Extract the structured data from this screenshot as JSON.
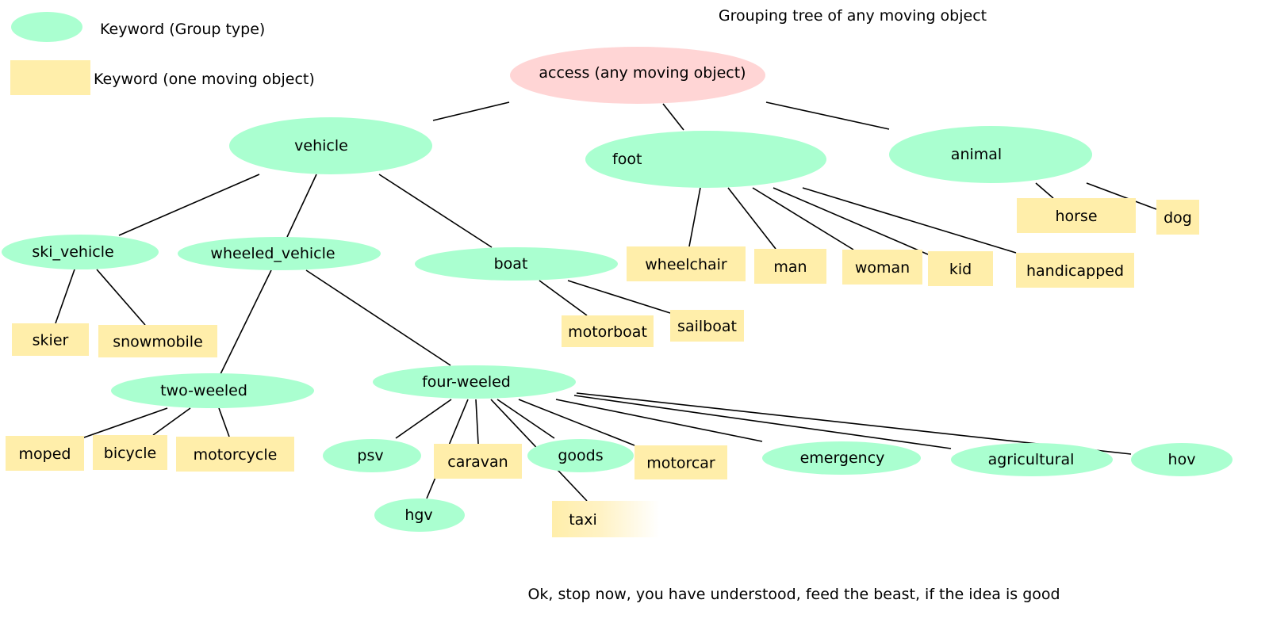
{
  "title": "Grouping tree of any moving object",
  "footer": "Ok, stop now, you have understood, feed the beast, if the idea is good",
  "legend": {
    "group": "Keyword (Group type)",
    "object": "Keyword (one moving object)"
  },
  "colors": {
    "root": "#ffd5d5",
    "group": "#aaffd0",
    "object": "#ffeeaa",
    "edge": "#000000"
  },
  "nodes": [
    {
      "id": "access",
      "label": "access (any moving object)",
      "type": "root"
    },
    {
      "id": "vehicle",
      "label": "vehicle",
      "type": "group"
    },
    {
      "id": "foot",
      "label": "foot",
      "type": "group"
    },
    {
      "id": "animal",
      "label": "animal",
      "type": "group"
    },
    {
      "id": "ski_vehicle",
      "label": "ski_vehicle",
      "type": "group"
    },
    {
      "id": "wheeled_vehicle",
      "label": "wheeled_vehicle",
      "type": "group"
    },
    {
      "id": "boat",
      "label": "boat",
      "type": "group"
    },
    {
      "id": "two_weeled",
      "label": "two-weeled",
      "type": "group"
    },
    {
      "id": "four_weeled",
      "label": "four-weeled",
      "type": "group"
    },
    {
      "id": "psv",
      "label": "psv",
      "type": "group"
    },
    {
      "id": "goods",
      "label": "goods",
      "type": "group"
    },
    {
      "id": "emergency",
      "label": "emergency",
      "type": "group"
    },
    {
      "id": "agricultural",
      "label": "agricultural",
      "type": "group"
    },
    {
      "id": "hov",
      "label": "hov",
      "type": "group"
    },
    {
      "id": "hgv",
      "label": "hgv",
      "type": "group"
    },
    {
      "id": "wheelchair",
      "label": "wheelchair",
      "type": "object"
    },
    {
      "id": "man",
      "label": "man",
      "type": "object"
    },
    {
      "id": "woman",
      "label": "woman",
      "type": "object"
    },
    {
      "id": "kid",
      "label": "kid",
      "type": "object"
    },
    {
      "id": "handicapped",
      "label": "handicapped",
      "type": "object"
    },
    {
      "id": "horse",
      "label": "horse",
      "type": "object"
    },
    {
      "id": "dog",
      "label": "dog",
      "type": "object"
    },
    {
      "id": "skier",
      "label": "skier",
      "type": "object"
    },
    {
      "id": "snowmobile",
      "label": "snowmobile",
      "type": "object"
    },
    {
      "id": "motorboat",
      "label": "motorboat",
      "type": "object"
    },
    {
      "id": "sailboat",
      "label": "sailboat",
      "type": "object"
    },
    {
      "id": "moped",
      "label": "moped",
      "type": "object"
    },
    {
      "id": "bicycle",
      "label": "bicycle",
      "type": "object"
    },
    {
      "id": "motorcycle",
      "label": "motorcycle",
      "type": "object"
    },
    {
      "id": "caravan",
      "label": "caravan",
      "type": "object"
    },
    {
      "id": "motorcar",
      "label": "motorcar",
      "type": "object"
    },
    {
      "id": "taxi",
      "label": "taxi",
      "type": "object"
    }
  ],
  "edges": [
    [
      "access",
      "vehicle"
    ],
    [
      "access",
      "foot"
    ],
    [
      "access",
      "animal"
    ],
    [
      "vehicle",
      "ski_vehicle"
    ],
    [
      "vehicle",
      "wheeled_vehicle"
    ],
    [
      "vehicle",
      "boat"
    ],
    [
      "foot",
      "wheelchair"
    ],
    [
      "foot",
      "man"
    ],
    [
      "foot",
      "woman"
    ],
    [
      "foot",
      "kid"
    ],
    [
      "foot",
      "handicapped"
    ],
    [
      "animal",
      "horse"
    ],
    [
      "animal",
      "dog"
    ],
    [
      "ski_vehicle",
      "skier"
    ],
    [
      "ski_vehicle",
      "snowmobile"
    ],
    [
      "wheeled_vehicle",
      "two_weeled"
    ],
    [
      "wheeled_vehicle",
      "four_weeled"
    ],
    [
      "boat",
      "motorboat"
    ],
    [
      "boat",
      "sailboat"
    ],
    [
      "two_weeled",
      "moped"
    ],
    [
      "two_weeled",
      "bicycle"
    ],
    [
      "two_weeled",
      "motorcycle"
    ],
    [
      "four_weeled",
      "psv"
    ],
    [
      "four_weeled",
      "hgv"
    ],
    [
      "four_weeled",
      "caravan"
    ],
    [
      "four_weeled",
      "taxi"
    ],
    [
      "four_weeled",
      "goods"
    ],
    [
      "four_weeled",
      "motorcar"
    ],
    [
      "four_weeled",
      "emergency"
    ],
    [
      "four_weeled",
      "agricultural"
    ],
    [
      "four_weeled",
      "hov"
    ]
  ]
}
